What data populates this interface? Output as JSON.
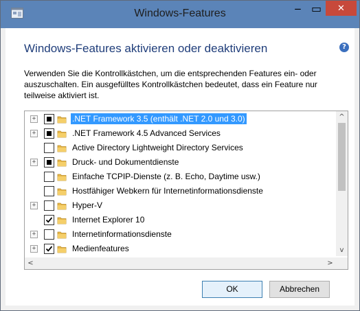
{
  "window": {
    "title": "Windows-Features",
    "minimize_symbol": "‒",
    "maximize_symbol": "▭",
    "close_symbol": "✕",
    "titlebar_color": "#5b84b8",
    "close_color": "#c7493b"
  },
  "dialog": {
    "heading": "Windows-Features aktivieren oder deaktivieren",
    "help_symbol": "?",
    "description": "Verwenden Sie die Kontrollkästchen, um die entsprechenden Features ein- oder auszuschalten. Ein ausgefülltes Kontrollkästchen bedeutet, dass ein Feature nur teilweise aktiviert ist."
  },
  "features": [
    {
      "label": ".NET Framework 3.5 (enthält .NET 2.0 und 3.0)",
      "expandable": true,
      "state": "partial",
      "selected": true
    },
    {
      "label": ".NET Framework 4.5 Advanced Services",
      "expandable": true,
      "state": "partial",
      "selected": false
    },
    {
      "label": "Active Directory Lightweight Directory Services",
      "expandable": false,
      "state": "unchecked",
      "selected": false
    },
    {
      "label": "Druck- und Dokumentdienste",
      "expandable": true,
      "state": "partial",
      "selected": false
    },
    {
      "label": "Einfache TCPIP-Dienste (z. B. Echo, Daytime usw.)",
      "expandable": false,
      "state": "unchecked",
      "selected": false
    },
    {
      "label": "Hostfähiger Webkern für Internetinformationsdienste",
      "expandable": false,
      "state": "unchecked",
      "selected": false
    },
    {
      "label": "Hyper-V",
      "expandable": true,
      "state": "unchecked",
      "selected": false
    },
    {
      "label": "Internet Explorer 10",
      "expandable": false,
      "state": "checked",
      "selected": false
    },
    {
      "label": "Internetinformationsdienste",
      "expandable": true,
      "state": "unchecked",
      "selected": false
    },
    {
      "label": "Medienfeatures",
      "expandable": true,
      "state": "checked",
      "selected": false
    }
  ],
  "tree_glyphs": {
    "expand": "+",
    "scroll_up": "^",
    "scroll_down": "v",
    "scroll_left": "<",
    "scroll_right": ">"
  },
  "buttons": {
    "ok": "OK",
    "cancel": "Abbrechen"
  },
  "colors": {
    "selection": "#3399ff",
    "heading": "#1f3d7a",
    "folder": "#e8b84a"
  }
}
